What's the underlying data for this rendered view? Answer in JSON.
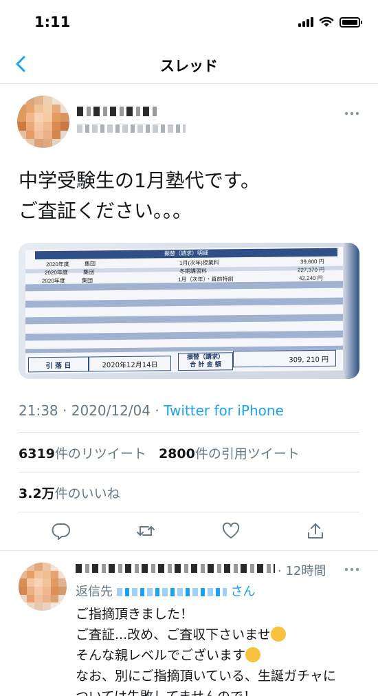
{
  "status_bar": {
    "time": "1:11"
  },
  "nav": {
    "title": "スレッド"
  },
  "tweet": {
    "text_line1": "中学受験生の1月塾代です。",
    "text_line2": "ご査証ください。。。",
    "media": {
      "header": "振替（請求）明細",
      "rows": [
        {
          "year": "2020年度",
          "type": "集団",
          "item": "1月(次年)授業料",
          "amount": "39,600 円"
        },
        {
          "year": "2020年度",
          "type": "集団",
          "item": "冬期講習料",
          "amount": "227,370 円"
        },
        {
          "year": "2020年度",
          "type": "集団",
          "item": "1月（次年）・直前特訓",
          "amount": "42,240 円"
        }
      ],
      "debit_label": "引 落 日",
      "debit_date": "2020年12月14日",
      "total_label_1": "振替（請求）",
      "total_label_2": "合 計 金 額",
      "total_amount": "309, 210 円"
    },
    "time": "21:38",
    "date": "2020/12/04",
    "separator": " · ",
    "client": "Twitter for iPhone",
    "retweets_count": "6319",
    "retweets_label": "件のリツイート",
    "quotes_count": "2800",
    "quotes_label": "件の引用ツイート",
    "likes_count": "3.2万",
    "likes_label": "件のいいね"
  },
  "reply": {
    "time": "· 12時間",
    "reply_prefix": "返信先",
    "reply_suffix": "さん",
    "lines": [
      "ご指摘頂きました！",
      "ご査証...改め、ご査収下さいませ",
      "そんな親レベルでございます",
      "なお、別にご指摘頂いている、生誕ガチャに",
      "ついては失敗してませんので！"
    ]
  },
  "colors": {
    "accent": "#1da1f2",
    "secondary_text": "#657786",
    "divider": "#dfe3e6"
  },
  "icons": [
    "back-icon",
    "more-icon",
    "reply-icon",
    "retweet-icon",
    "like-icon",
    "share-icon"
  ]
}
